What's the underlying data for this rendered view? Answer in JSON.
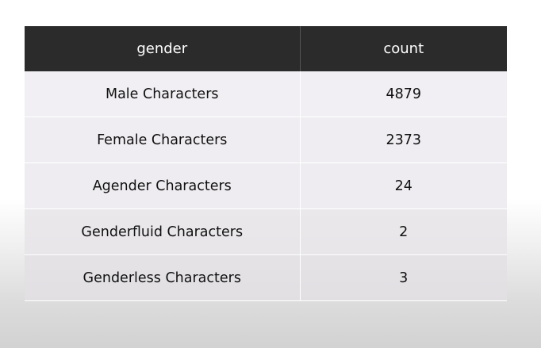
{
  "table": {
    "headers": {
      "gender": "gender",
      "count": "count"
    },
    "rows": [
      {
        "gender": "Male Characters",
        "count": "4879"
      },
      {
        "gender": "Female Characters",
        "count": "2373"
      },
      {
        "gender": "Agender Characters",
        "count": "24"
      },
      {
        "gender": "Genderfluid Characters",
        "count": "2"
      },
      {
        "gender": "Genderless Characters",
        "count": "3"
      }
    ]
  },
  "colors": {
    "header_background": "#2b2b2b",
    "header_text": "#ffffff",
    "row_background": "#f0eef2"
  }
}
